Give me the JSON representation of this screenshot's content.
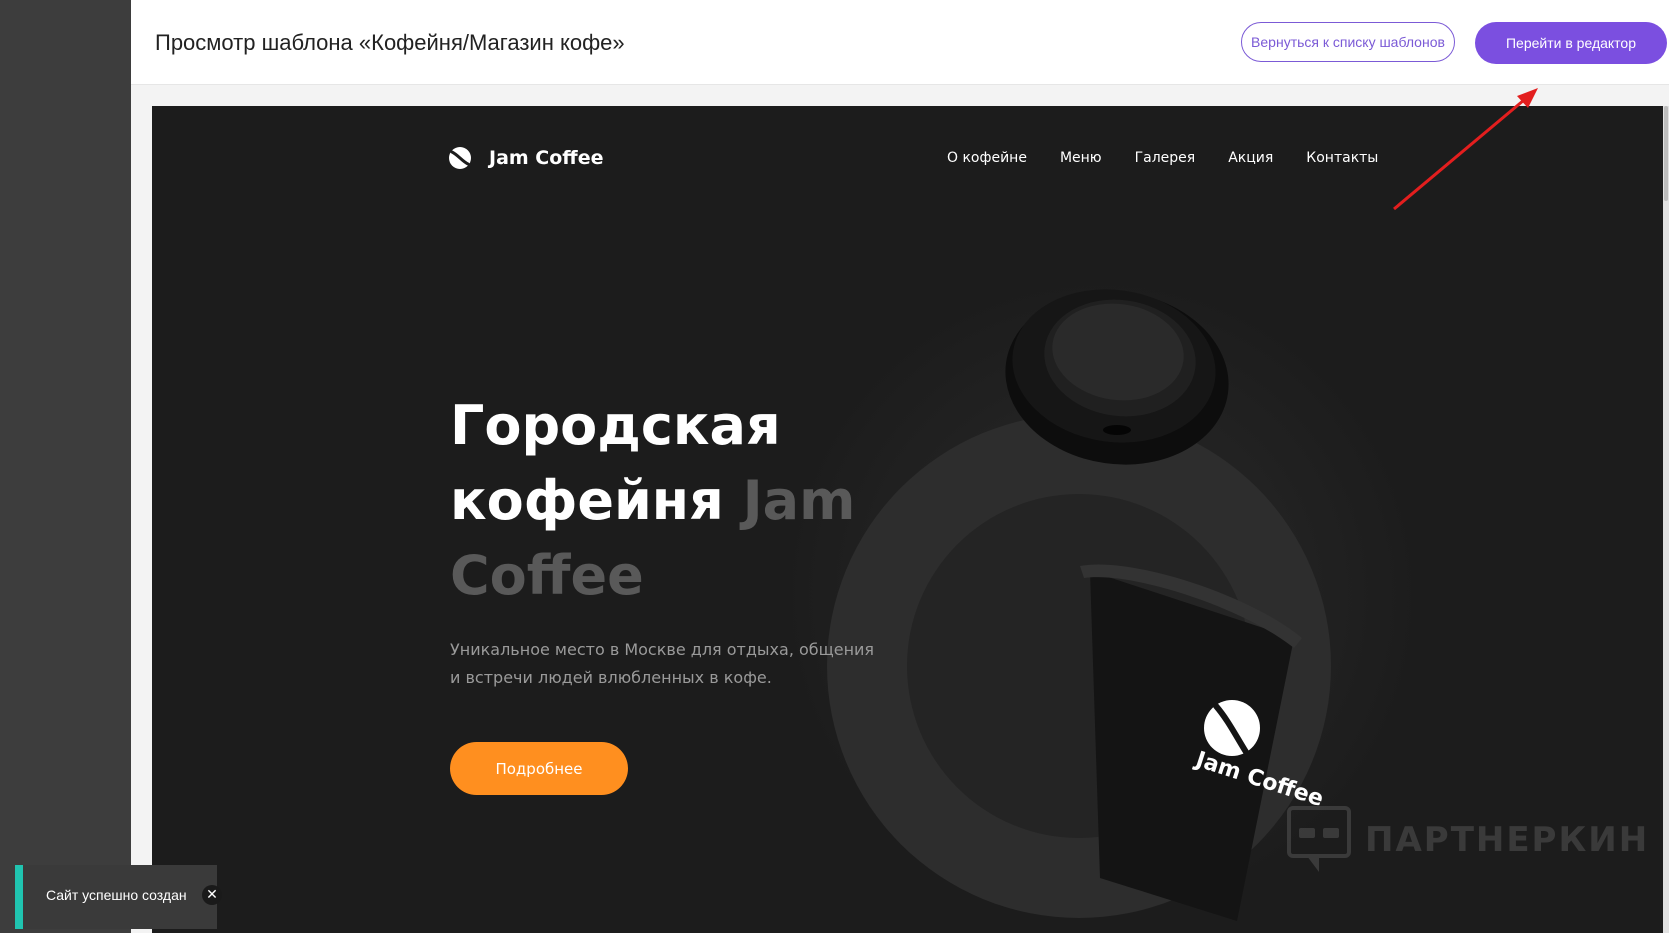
{
  "header": {
    "title": "Просмотр шаблона «Кофейня/Магазин кофе»",
    "back_button": "Вернуться к списку шаблонов",
    "editor_button": "Перейти в редактор"
  },
  "site": {
    "brand": "Jam Coffee",
    "nav": [
      "О кофейне",
      "Меню",
      "Галерея",
      "Акция",
      "Контакты"
    ],
    "hero_title_line1": "Городская",
    "hero_title_line2_white": "кофейня",
    "hero_title_line2_muted": "Jam",
    "hero_title_line3_muted": "Coffee",
    "hero_subtitle_line1": "Уникальное место в Москве для отдыха, общения",
    "hero_subtitle_line2": "и встречи людей влюбленных в кофе.",
    "cta_button": "Подробнее",
    "cup_brand": "Jam Coffee"
  },
  "watermark": {
    "text": "ПАРТНЕРКИН"
  },
  "toast": {
    "message": "Сайт успешно создан",
    "close_symbol": "✕"
  },
  "colors": {
    "accent_purple": "#7b4fe0",
    "cta_orange": "#ff8f1f",
    "toast_accent": "#20c4b0",
    "arrow_red": "#e31e1e",
    "site_background": "#1c1c1c"
  }
}
